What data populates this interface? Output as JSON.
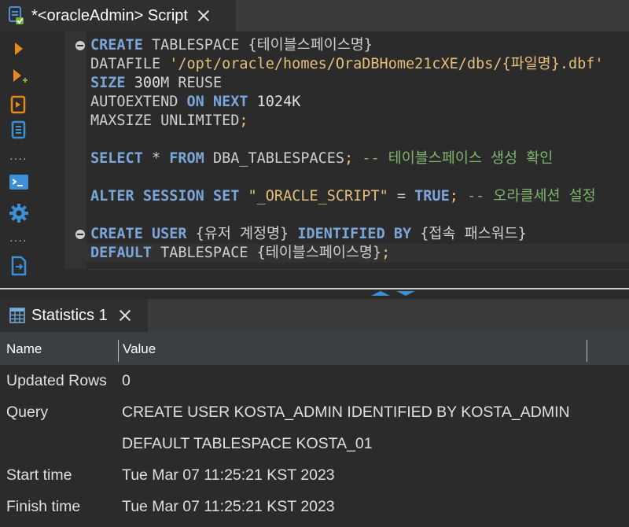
{
  "editor_tab": {
    "title": "*<oracleAdmin> Script"
  },
  "toolbar": {
    "icons": [
      "run-statement-icon",
      "run-script-icon",
      "explain-plan-icon",
      "load-script-icon",
      "terminal-icon",
      "settings-icon",
      "export-icon"
    ]
  },
  "code": {
    "lines": [
      [
        {
          "t": "CREATE",
          "c": "kw"
        },
        {
          "t": " TABLESPACE {테이블스페이스명}",
          "c": ""
        }
      ],
      [
        {
          "t": "DATAFILE ",
          "c": ""
        },
        {
          "t": "'/opt/oracle/homes/OraDBHome21cXE/dbs/{파일명}.dbf'",
          "c": "str"
        }
      ],
      [
        {
          "t": "SIZE",
          "c": "kw"
        },
        {
          "t": " 300",
          "c": "num"
        },
        {
          "t": "M REUSE",
          "c": ""
        }
      ],
      [
        {
          "t": "AUTOEXTEND ",
          "c": ""
        },
        {
          "t": "ON",
          "c": "kw"
        },
        {
          "t": " ",
          "c": ""
        },
        {
          "t": "NEXT",
          "c": "kw"
        },
        {
          "t": " 1024K",
          "c": "num"
        }
      ],
      [
        {
          "t": "MAXSIZE UNLIMITED",
          "c": ""
        },
        {
          "t": ";",
          "c": "semi"
        }
      ],
      [],
      [
        {
          "t": "SELECT",
          "c": "kw"
        },
        {
          "t": " * ",
          "c": ""
        },
        {
          "t": "FROM",
          "c": "kw"
        },
        {
          "t": " DBA_TABLESPACES",
          "c": ""
        },
        {
          "t": ";",
          "c": "semi"
        },
        {
          "t": " -- 테이블스페이스 생성 확인",
          "c": "cmt"
        }
      ],
      [],
      [
        {
          "t": "ALTER",
          "c": "kw"
        },
        {
          "t": " ",
          "c": ""
        },
        {
          "t": "SESSION",
          "c": "kw"
        },
        {
          "t": " ",
          "c": ""
        },
        {
          "t": "SET",
          "c": "kw"
        },
        {
          "t": " ",
          "c": ""
        },
        {
          "t": "\"_ORACLE_SCRIPT\"",
          "c": "str"
        },
        {
          "t": " = ",
          "c": ""
        },
        {
          "t": "TRUE",
          "c": "kw"
        },
        {
          "t": ";",
          "c": "semi"
        },
        {
          "t": " -- 오라클세션 설정",
          "c": "cmt"
        }
      ],
      [],
      [
        {
          "t": "CREATE",
          "c": "kw"
        },
        {
          "t": " ",
          "c": ""
        },
        {
          "t": "USER",
          "c": "kw"
        },
        {
          "t": " {유저 계정명} ",
          "c": ""
        },
        {
          "t": "IDENTIFIED",
          "c": "kw"
        },
        {
          "t": " ",
          "c": ""
        },
        {
          "t": "BY",
          "c": "kw"
        },
        {
          "t": " {접속 패스워드}",
          "c": ""
        }
      ],
      [
        {
          "t": "DEFAULT",
          "c": "kw"
        },
        {
          "t": " TABLESPACE {테이블스페이스명}",
          "c": ""
        },
        {
          "t": ";",
          "c": "semi"
        }
      ]
    ]
  },
  "stats_tab": {
    "title": "Statistics 1"
  },
  "table": {
    "headers": {
      "name": "Name",
      "value": "Value"
    },
    "rows": [
      {
        "name": "Updated Rows",
        "value": "0"
      },
      {
        "name": "Query",
        "value": "CREATE USER KOSTA_ADMIN IDENTIFIED BY KOSTA_ADMIN"
      },
      {
        "name": "",
        "value": "DEFAULT TABLESPACE KOSTA_01"
      },
      {
        "name": "Start time",
        "value": "Tue Mar 07 11:25:21 KST 2023"
      },
      {
        "name": "Finish time",
        "value": "Tue Mar 07 11:25:21 KST 2023"
      }
    ]
  },
  "colors": {
    "keyword": "#7aa6da",
    "string": "#e6c07b",
    "comment": "#7fb56f",
    "accent_orange": "#e8891f",
    "accent_blue": "#3d8fd6"
  }
}
